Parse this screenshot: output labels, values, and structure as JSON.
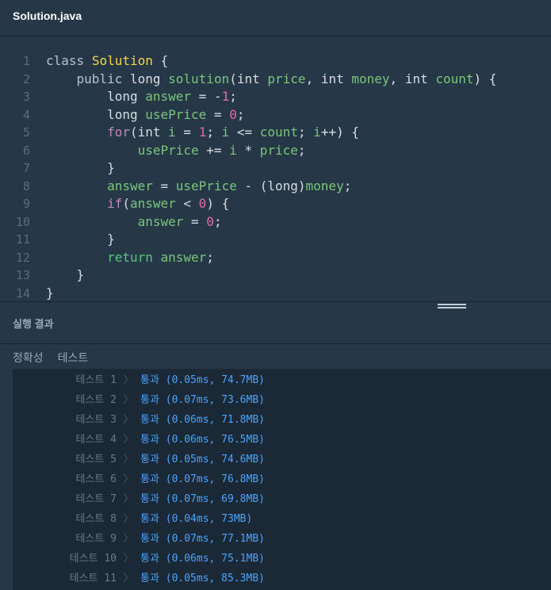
{
  "file": {
    "title": "Solution.java"
  },
  "code": {
    "line_numbers": [
      "1",
      "2",
      "3",
      "4",
      "5",
      "6",
      "7",
      "8",
      "9",
      "10",
      "11",
      "12",
      "13",
      "14"
    ]
  },
  "results": {
    "title": "실행 결과",
    "tabs": [
      "정확성",
      "테스트"
    ],
    "rows": [
      {
        "label": "테스트 1",
        "status": "통과 (0.05ms, 74.7MB)"
      },
      {
        "label": "테스트 2",
        "status": "통과 (0.07ms, 73.6MB)"
      },
      {
        "label": "테스트 3",
        "status": "통과 (0.06ms, 71.8MB)"
      },
      {
        "label": "테스트 4",
        "status": "통과 (0.06ms, 76.5MB)"
      },
      {
        "label": "테스트 5",
        "status": "통과 (0.05ms, 74.6MB)"
      },
      {
        "label": "테스트 6",
        "status": "통과 (0.07ms, 76.8MB)"
      },
      {
        "label": "테스트 7",
        "status": "통과 (0.07ms, 69.8MB)"
      },
      {
        "label": "테스트 8",
        "status": "통과 (0.04ms, 73MB)"
      },
      {
        "label": "테스트 9",
        "status": "통과 (0.07ms, 77.1MB)"
      },
      {
        "label": "테스트 10",
        "status": "통과 (0.06ms, 75.1MB)"
      },
      {
        "label": "테스트 11",
        "status": "통과 (0.05ms, 85.3MB)"
      }
    ],
    "separator": "〉"
  }
}
